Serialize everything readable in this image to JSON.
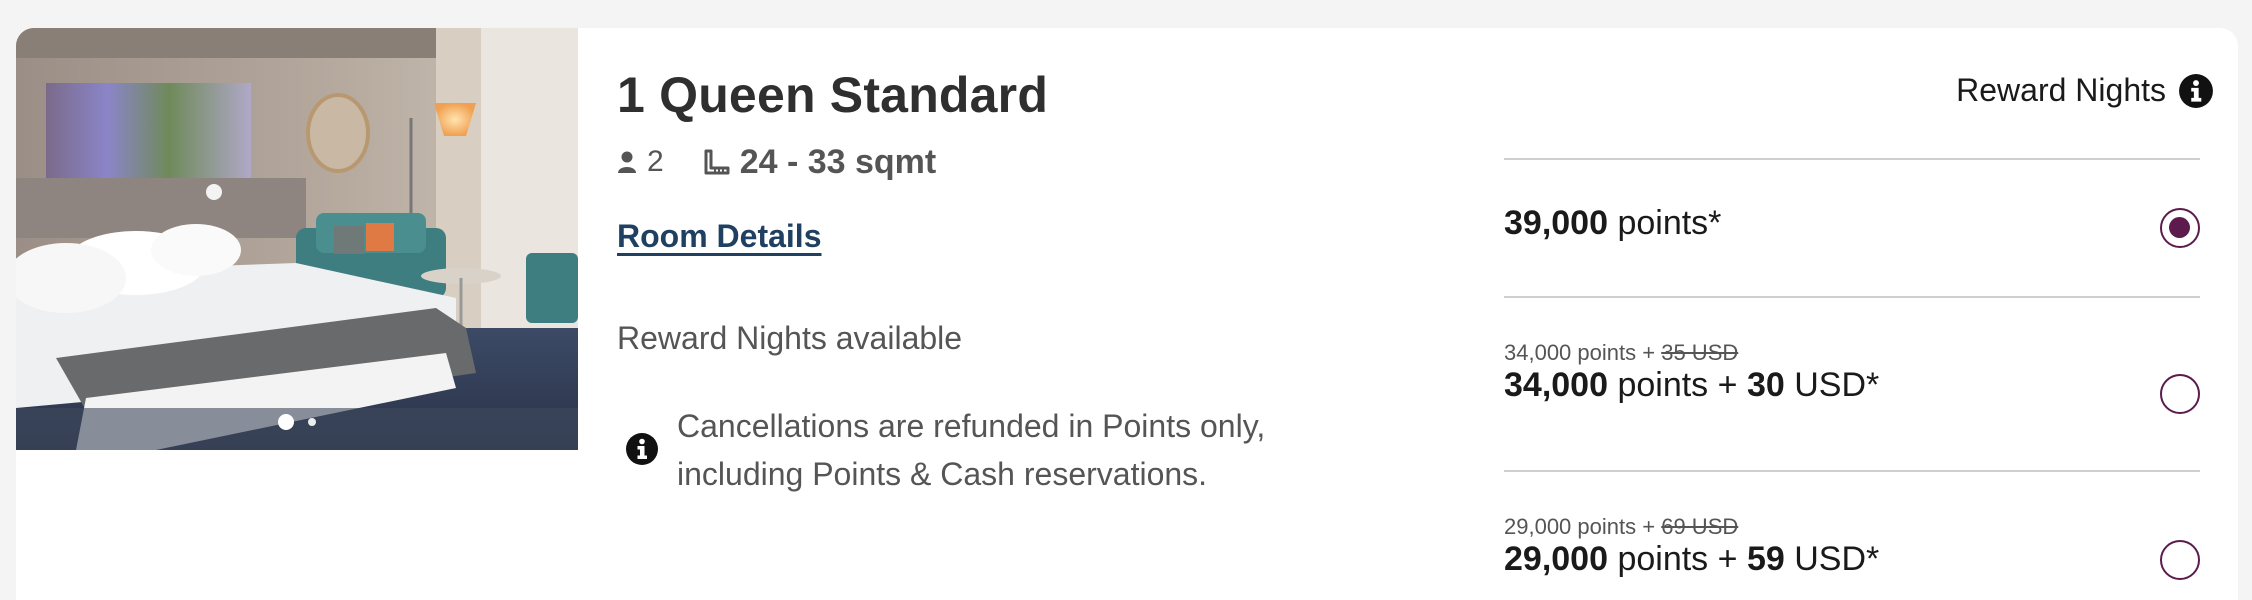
{
  "room": {
    "title": "1 Queen Standard",
    "guests": "2",
    "size": "24 - 33 sqmt",
    "details_link": "Room Details",
    "availability": "Reward Nights available",
    "cancellation": "Cancellations are refunded in Points only, including Points & Cash reservations.",
    "photo": {
      "image_count": 2,
      "active_index": 0
    }
  },
  "rates": {
    "header": "Reward Nights",
    "options": [
      {
        "original": null,
        "points": "39,000",
        "points_label": "points*",
        "cash": null,
        "cash_label": null,
        "selected": true
      },
      {
        "original": {
          "points": "34,000 points",
          "plus": "+",
          "cash": "35 USD"
        },
        "points": "34,000",
        "points_label": "points",
        "plus": "+",
        "cash": "30",
        "cash_label": "USD*",
        "selected": false
      },
      {
        "original": {
          "points": "29,000 points",
          "plus": "+",
          "cash": "69 USD"
        },
        "points": "29,000",
        "points_label": "points",
        "plus": "+",
        "cash": "59",
        "cash_label": "USD*",
        "selected": false
      }
    ]
  },
  "colors": {
    "accent": "#5c1b4c",
    "link": "#1f4060",
    "divider": "#cfcfcf",
    "page_bg": "#f4f4f4"
  },
  "icons": [
    "person-icon",
    "ruler-icon",
    "info-icon",
    "radio-button"
  ]
}
